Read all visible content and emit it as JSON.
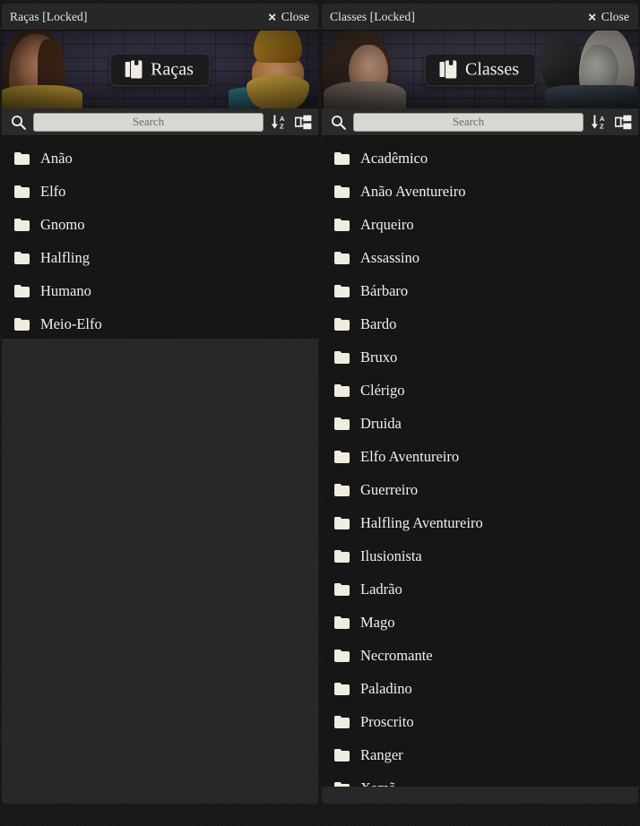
{
  "panels": [
    {
      "id": "racas",
      "titlebar": {
        "title": "Raças [Locked]",
        "close_label": "Close",
        "close_icon": "close-x-icon"
      },
      "banner": {
        "button_label": "Raças",
        "button_icon": "compendium-book-icon"
      },
      "search": {
        "placeholder": "Search",
        "value": "",
        "search_icon": "search-icon",
        "sort_icon": "sort-alphabetical-descending-icon",
        "tree_icon": "folder-tree-icon"
      },
      "items": [
        {
          "label": "Anão",
          "icon": "folder-icon"
        },
        {
          "label": "Elfo",
          "icon": "folder-icon"
        },
        {
          "label": "Gnomo",
          "icon": "folder-icon"
        },
        {
          "label": "Halfling",
          "icon": "folder-icon"
        },
        {
          "label": "Humano",
          "icon": "folder-icon"
        },
        {
          "label": "Meio-Elfo",
          "icon": "folder-icon"
        }
      ]
    },
    {
      "id": "classes",
      "titlebar": {
        "title": "Classes [Locked]",
        "close_label": "Close",
        "close_icon": "close-x-icon"
      },
      "banner": {
        "button_label": "Classes",
        "button_icon": "compendium-book-icon"
      },
      "search": {
        "placeholder": "Search",
        "value": "",
        "search_icon": "search-icon",
        "sort_icon": "sort-alphabetical-descending-icon",
        "tree_icon": "folder-tree-icon"
      },
      "items": [
        {
          "label": "Acadêmico",
          "icon": "folder-icon"
        },
        {
          "label": "Anão Aventureiro",
          "icon": "folder-icon"
        },
        {
          "label": "Arqueiro",
          "icon": "folder-icon"
        },
        {
          "label": "Assassino",
          "icon": "folder-icon"
        },
        {
          "label": "Bárbaro",
          "icon": "folder-icon"
        },
        {
          "label": "Bardo",
          "icon": "folder-icon"
        },
        {
          "label": "Bruxo",
          "icon": "folder-icon"
        },
        {
          "label": "Clérigo",
          "icon": "folder-icon"
        },
        {
          "label": "Druida",
          "icon": "folder-icon"
        },
        {
          "label": "Elfo Aventureiro",
          "icon": "folder-icon"
        },
        {
          "label": "Guerreiro",
          "icon": "folder-icon"
        },
        {
          "label": "Halfling Aventureiro",
          "icon": "folder-icon"
        },
        {
          "label": "Ilusionista",
          "icon": "folder-icon"
        },
        {
          "label": "Ladrão",
          "icon": "folder-icon"
        },
        {
          "label": "Mago",
          "icon": "folder-icon"
        },
        {
          "label": "Necromante",
          "icon": "folder-icon"
        },
        {
          "label": "Paladino",
          "icon": "folder-icon"
        },
        {
          "label": "Proscrito",
          "icon": "folder-icon"
        },
        {
          "label": "Ranger",
          "icon": "folder-icon"
        },
        {
          "label": "Xamã",
          "icon": "folder-icon"
        }
      ]
    }
  ],
  "colors": {
    "panel_bg": "#161616",
    "titlebar_bg": "#272727",
    "searchbar_bg": "#2a2a28",
    "search_input_bg": "#d8d8d0",
    "text": "#f2f0e8",
    "empty_bg": "#2a2a2a"
  }
}
